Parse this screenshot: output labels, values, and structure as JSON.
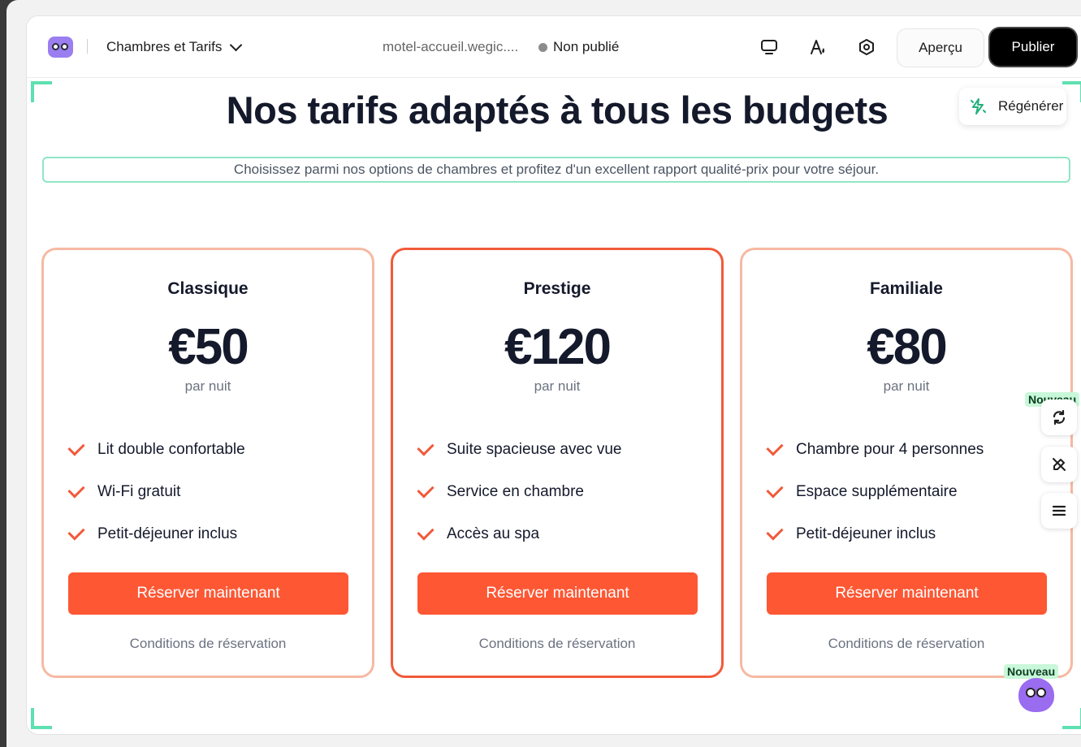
{
  "topbar": {
    "page_name": "Chambres et Tarifs",
    "domain": "motel-accueil.wegic....",
    "status": "Non publié",
    "preview_label": "Aperçu",
    "publish_label": "Publier"
  },
  "hero": {
    "title": "Nos tarifs adaptés à tous les budgets",
    "subtitle": "Choisissez parmi nos options de chambres et profitez d'un excellent rapport qualité-prix pour votre séjour.",
    "regenerate_label": "Régénérer"
  },
  "plans": [
    {
      "name": "Classique",
      "price": "€50",
      "period": "par nuit",
      "features": [
        "Lit double confortable",
        "Wi-Fi gratuit",
        "Petit-déjeuner inclus"
      ],
      "cta": "Réserver maintenant",
      "terms": "Conditions de réservation"
    },
    {
      "name": "Prestige",
      "price": "€120",
      "period": "par nuit",
      "features": [
        "Suite spacieuse avec vue",
        "Service en chambre",
        "Accès au spa"
      ],
      "cta": "Réserver maintenant",
      "terms": "Conditions de réservation"
    },
    {
      "name": "Familiale",
      "price": "€80",
      "period": "par nuit",
      "features": [
        "Chambre pour 4 personnes",
        "Espace supplémentaire",
        "Petit-déjeuner inclus"
      ],
      "cta": "Réserver maintenant",
      "terms": "Conditions de réservation"
    }
  ],
  "side_tools": {
    "badge_new": "Nouveau",
    "mascot_badge": "Nouveau"
  },
  "colors": {
    "accent": "#fd5734",
    "card_border": "#f6b9a3",
    "featured_border": "#f15a3a",
    "corner_guide": "#5ee0b0",
    "text_dark": "#14192b"
  },
  "icons": [
    "logo-icon",
    "chevron-down-icon",
    "status-dot-icon",
    "monitor-icon",
    "font-style-icon",
    "settings-icon",
    "regenerate-icon",
    "check-icon",
    "sync-icon",
    "edit-icon",
    "menu-icon",
    "mascot-icon"
  ]
}
